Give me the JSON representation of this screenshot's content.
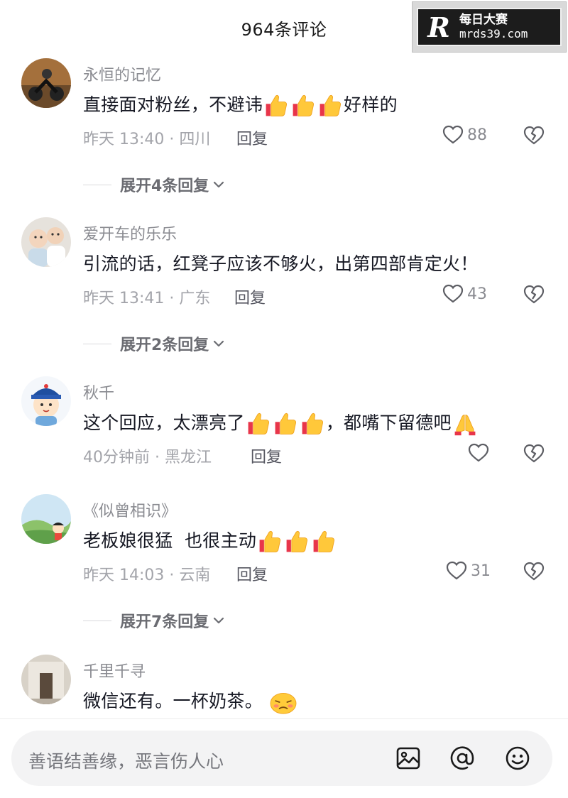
{
  "header": {
    "title": "964条评论"
  },
  "watermark": {
    "logo": "R",
    "line1": "每日大赛",
    "line2": "mrds39.com"
  },
  "comments": [
    {
      "username": "永恒的记忆",
      "text_before": "直接面对粉丝，不避讳",
      "text_after": "好样的",
      "meta": "昨天 13:40 · 四川",
      "reply_label": "回复",
      "likes": "88",
      "expand": "展开4条回复"
    },
    {
      "username": "爱开车的乐乐",
      "text_before": "引流的话，红凳子应该不够火，出第四部肯定火！",
      "text_after": "",
      "meta": "昨天 13:41 · 广东",
      "reply_label": "回复",
      "likes": "43",
      "expand": "展开2条回复"
    },
    {
      "username": "秋千",
      "text_before": "这个回应，太漂亮了",
      "text_after": "，都嘴下留德吧",
      "meta": "40分钟前 · 黑龙江",
      "reply_label": "回复",
      "likes": "",
      "expand": ""
    },
    {
      "username": "《似曾相识》",
      "text_before": "老板娘很猛  也很主动",
      "text_after": "",
      "meta": "昨天 14:03 · 云南",
      "reply_label": "回复",
      "likes": "31",
      "expand": "展开7条回复"
    },
    {
      "username": "千里千寻",
      "text_before": "微信还有。一杯奶茶。",
      "text_after": "",
      "meta": "",
      "reply_label": "",
      "likes": "",
      "expand": ""
    }
  ],
  "input": {
    "placeholder": "善语结善缘，恶言伤人心",
    "icons": [
      "image-icon",
      "at-icon",
      "emoji-icon"
    ]
  },
  "colors": {
    "text": "#161823",
    "secondary": "#8a8b91",
    "meta": "#a3a4aa",
    "emoji": "#f7b52c"
  }
}
